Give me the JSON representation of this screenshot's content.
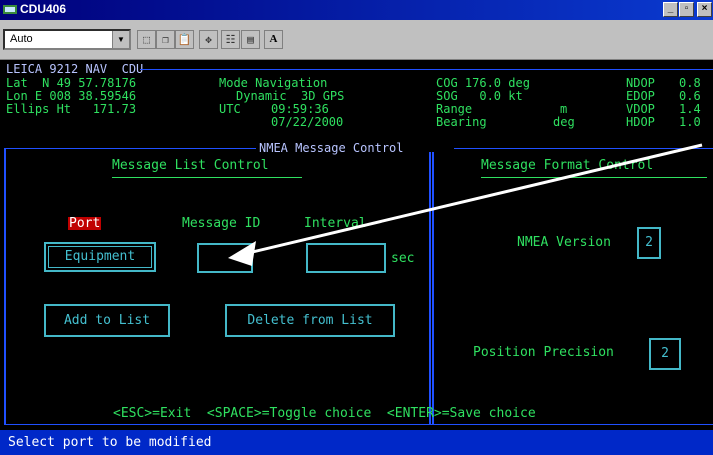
{
  "window": {
    "title": "CDU406",
    "minimize_glyph": "_",
    "maximize_glyph": "▫",
    "close_glyph": "×"
  },
  "toolbar": {
    "font_select_value": "Auto",
    "bold_button_label": "A"
  },
  "header": {
    "device": "LEICA 9212 NAV  CDU",
    "lat": "Lat  N 49 57.78176",
    "lon": "Lon E 008 38.59546",
    "ellips": "Ellips Ht   171.73",
    "mode": "Mode Navigation",
    "dynamic": "Dynamic  3D GPS",
    "utc_label": "UTC",
    "utc_value": "09:59:36",
    "date": "07/22/2000",
    "cog": "COG 176.0 deg",
    "sog": "SOG   0.0 kt",
    "range_label": "Range",
    "range_unit": "m",
    "bearing_label": "Bearing",
    "bearing_unit": "deg",
    "dop": [
      {
        "label": "NDOP",
        "value": "0.8"
      },
      {
        "label": "EDOP",
        "value": "0.6"
      },
      {
        "label": "VDOP",
        "value": "1.4"
      },
      {
        "label": "HDOP",
        "value": "1.0"
      }
    ]
  },
  "nmea": {
    "panel_title": "NMEA Message Control",
    "list_control": {
      "title": "Message List Control",
      "port_label": "Port",
      "message_id_label": "Message ID",
      "interval_label": "Interval",
      "port_value": "Equipment",
      "message_id_value": "",
      "interval_value": "",
      "interval_unit": "sec",
      "add_button": "Add to List",
      "delete_button": "Delete from List"
    },
    "format_control": {
      "title": "Message Format Control",
      "nmea_version_label": "NMEA Version",
      "nmea_version_value": "2",
      "position_precision_label": "Position Precision",
      "position_precision_value": "2"
    },
    "hint": "<ESC>=Exit  <SPACE>=Toggle choice  <ENTER>=Save choice"
  },
  "status_bar": {
    "text": "Select port to be modified"
  },
  "colors": {
    "title_bar": "#00007b",
    "green_text": "#2fe060",
    "cyan_box": "#44b8c8",
    "blue_line": "#2050ff",
    "port_highlight": "#c00000",
    "status_bar": "#0028c8"
  }
}
